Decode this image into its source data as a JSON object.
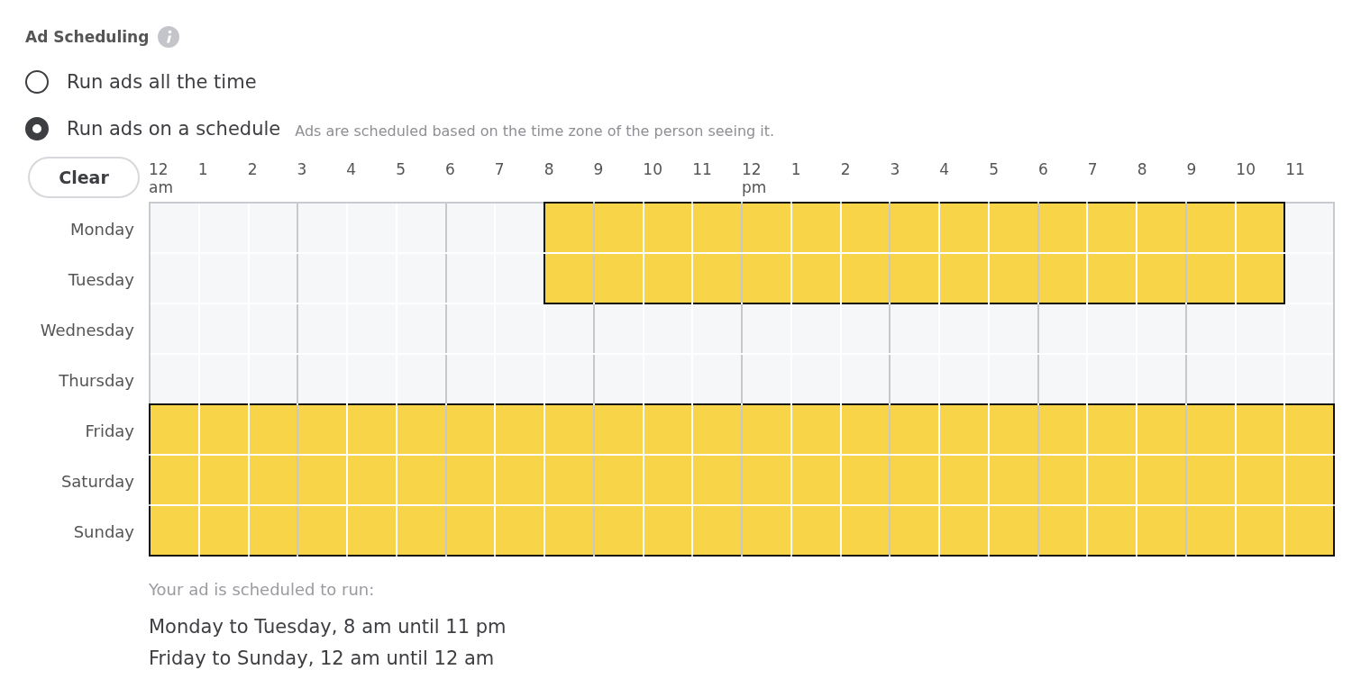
{
  "section": {
    "title": "Ad Scheduling"
  },
  "options": [
    {
      "label": "Run ads all the time",
      "selected": false
    },
    {
      "label": "Run ads on a schedule",
      "selected": true,
      "note": "Ads are scheduled based on the time zone of the person seeing it."
    }
  ],
  "clear_button": "Clear",
  "hours": [
    {
      "label": "12",
      "sub": "am"
    },
    {
      "label": "1"
    },
    {
      "label": "2"
    },
    {
      "label": "3"
    },
    {
      "label": "4"
    },
    {
      "label": "5"
    },
    {
      "label": "6"
    },
    {
      "label": "7"
    },
    {
      "label": "8"
    },
    {
      "label": "9"
    },
    {
      "label": "10"
    },
    {
      "label": "11"
    },
    {
      "label": "12",
      "sub": "pm"
    },
    {
      "label": "1"
    },
    {
      "label": "2"
    },
    {
      "label": "3"
    },
    {
      "label": "4"
    },
    {
      "label": "5"
    },
    {
      "label": "6"
    },
    {
      "label": "7"
    },
    {
      "label": "8"
    },
    {
      "label": "9"
    },
    {
      "label": "10"
    },
    {
      "label": "11"
    }
  ],
  "days": [
    {
      "name": "Monday",
      "slots": [
        false,
        false,
        false,
        false,
        false,
        false,
        false,
        false,
        true,
        true,
        true,
        true,
        true,
        true,
        true,
        true,
        true,
        true,
        true,
        true,
        true,
        true,
        true,
        false
      ]
    },
    {
      "name": "Tuesday",
      "slots": [
        false,
        false,
        false,
        false,
        false,
        false,
        false,
        false,
        true,
        true,
        true,
        true,
        true,
        true,
        true,
        true,
        true,
        true,
        true,
        true,
        true,
        true,
        true,
        false
      ]
    },
    {
      "name": "Wednesday",
      "slots": [
        false,
        false,
        false,
        false,
        false,
        false,
        false,
        false,
        false,
        false,
        false,
        false,
        false,
        false,
        false,
        false,
        false,
        false,
        false,
        false,
        false,
        false,
        false,
        false
      ]
    },
    {
      "name": "Thursday",
      "slots": [
        false,
        false,
        false,
        false,
        false,
        false,
        false,
        false,
        false,
        false,
        false,
        false,
        false,
        false,
        false,
        false,
        false,
        false,
        false,
        false,
        false,
        false,
        false,
        false
      ]
    },
    {
      "name": "Friday",
      "slots": [
        true,
        true,
        true,
        true,
        true,
        true,
        true,
        true,
        true,
        true,
        true,
        true,
        true,
        true,
        true,
        true,
        true,
        true,
        true,
        true,
        true,
        true,
        true,
        true
      ]
    },
    {
      "name": "Saturday",
      "slots": [
        true,
        true,
        true,
        true,
        true,
        true,
        true,
        true,
        true,
        true,
        true,
        true,
        true,
        true,
        true,
        true,
        true,
        true,
        true,
        true,
        true,
        true,
        true,
        true
      ]
    },
    {
      "name": "Sunday",
      "slots": [
        true,
        true,
        true,
        true,
        true,
        true,
        true,
        true,
        true,
        true,
        true,
        true,
        true,
        true,
        true,
        true,
        true,
        true,
        true,
        true,
        true,
        true,
        true,
        true
      ]
    }
  ],
  "summary": {
    "heading": "Your ad is scheduled to run:",
    "lines": [
      "Monday to Tuesday, 8 am until 11 pm",
      "Friday to Sunday, 12 am until 12 am"
    ]
  }
}
